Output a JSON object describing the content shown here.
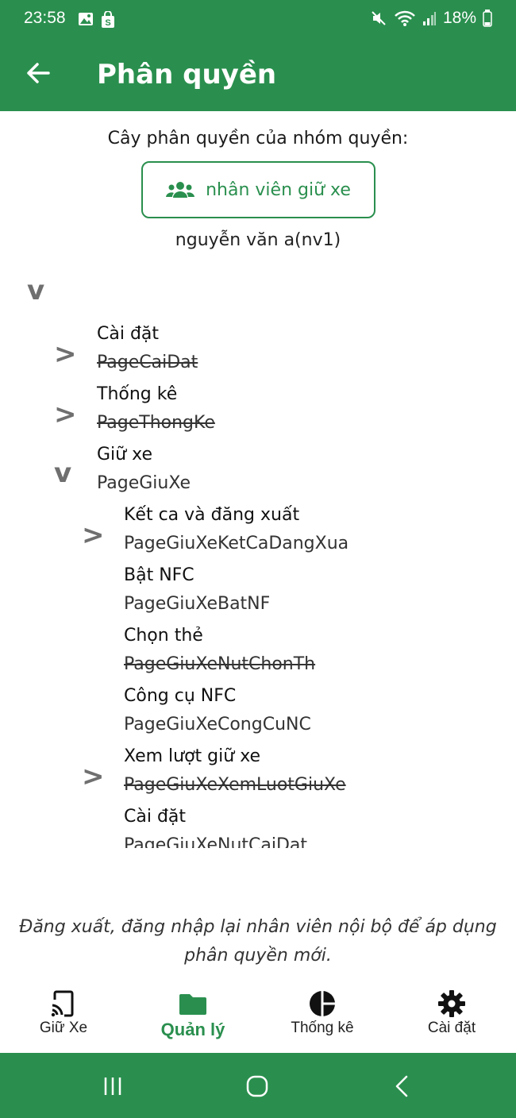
{
  "status": {
    "time": "23:58",
    "battery": "18%"
  },
  "appbar": {
    "title": "Phân quyền"
  },
  "permission": {
    "heading": "Cây phân quyền của nhóm quyền:",
    "group_button": "nhân viên giữ xe",
    "user": "nguyễn văn a(nv1)"
  },
  "tree": {
    "root_toggle": "v",
    "nodes": [
      {
        "toggle": ">",
        "title": "Cài đặt",
        "page": "PageCaiDat",
        "disabled": true
      },
      {
        "toggle": ">",
        "title": "Thống kê",
        "page": "PageThongKe",
        "disabled": true
      },
      {
        "toggle": "v",
        "title": "Giữ xe",
        "page": "PageGiuXe",
        "disabled": false
      },
      {
        "toggle": ">",
        "title": "Kết ca và đăng xuất",
        "page": "PageGiuXeKetCaDangXua",
        "disabled": false
      },
      {
        "toggle": "",
        "title": "Bật NFC",
        "page": "PageGiuXeBatNF",
        "disabled": false
      },
      {
        "toggle": "",
        "title": "Chọn thẻ",
        "page": "PageGiuXeNutChonTh",
        "disabled": true
      },
      {
        "toggle": "",
        "title": "Công cụ NFC",
        "page": "PageGiuXeCongCuNC",
        "disabled": false
      },
      {
        "toggle": ">",
        "title": "Xem lượt giữ xe",
        "page": "PageGiuXeXemLuotGiuXe",
        "disabled": true
      },
      {
        "toggle": "",
        "title": "Cài đặt",
        "page": "PageGiuXeNutCaiDat",
        "disabled": false
      }
    ]
  },
  "notice": "Đăng xuất, đăng nhập lại nhân viên nội bộ để áp dụng phân quyền mới.",
  "bottom_nav": {
    "items": [
      {
        "label": "Giữ Xe",
        "icon": "cast-icon",
        "active": false
      },
      {
        "label": "Quản lý",
        "icon": "folder-icon",
        "active": true
      },
      {
        "label": "Thống kê",
        "icon": "pie-chart-icon",
        "active": false
      },
      {
        "label": "Cài đặt",
        "icon": "gear-icon",
        "active": false
      }
    ]
  },
  "colors": {
    "primary": "#2a8f4e",
    "toggle": "#6f6f6f"
  }
}
